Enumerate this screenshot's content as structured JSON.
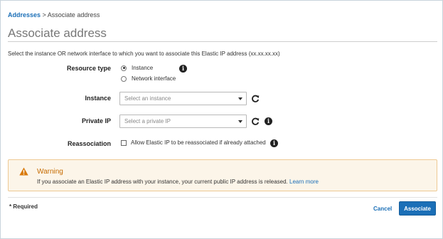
{
  "breadcrumb": {
    "parent": "Addresses",
    "separator": " > ",
    "current": "Associate address"
  },
  "page": {
    "title": "Associate address",
    "intro": "Select the instance OR network interface to which you want to associate this Elastic IP address (xx.xx.xx.xx)"
  },
  "form": {
    "resource_type": {
      "label": "Resource type",
      "options": [
        "Instance",
        "Network interface"
      ],
      "selected": "Instance"
    },
    "instance": {
      "label": "Instance",
      "placeholder": "Select an instance"
    },
    "private_ip": {
      "label": "Private IP",
      "placeholder": "Select a private IP"
    },
    "reassociation": {
      "label": "Reassociation",
      "checkbox_label": "Allow Elastic IP to be reassociated if already attached",
      "checked": false
    }
  },
  "warning": {
    "title": "Warning",
    "text": "If you associate an Elastic IP address with your instance, your current public IP address is released.",
    "link": "Learn more"
  },
  "footer": {
    "required": "* Required",
    "cancel": "Cancel",
    "associate": "Associate"
  },
  "colors": {
    "accent": "#1b6fb7",
    "warning_title": "#c66b00",
    "warning_bg": "#fcf5e9",
    "warning_border": "#eec993"
  },
  "icons": [
    "info-icon",
    "refresh-icon",
    "chevron-down-icon",
    "warning-icon"
  ]
}
